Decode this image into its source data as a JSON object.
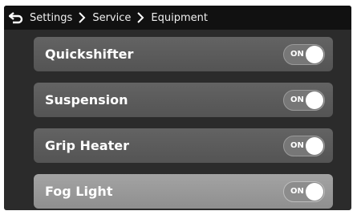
{
  "breadcrumb": [
    "Settings",
    "Service",
    "Equipment"
  ],
  "items": [
    {
      "label": "Quickshifter",
      "toggle": "ON"
    },
    {
      "label": "Suspension",
      "toggle": "ON"
    },
    {
      "label": "Grip Heater",
      "toggle": "ON"
    },
    {
      "label": "Fog Light",
      "toggle": "ON",
      "selected": true
    }
  ],
  "colors": {
    "background": "#2b2b2b",
    "topbar": "#111111",
    "row": "#5c5c5c",
    "row_selected": "#999999",
    "knob": "#ffffff"
  },
  "icons": {
    "back": "back-arrow-icon",
    "separator": "chevron-right-icon"
  }
}
